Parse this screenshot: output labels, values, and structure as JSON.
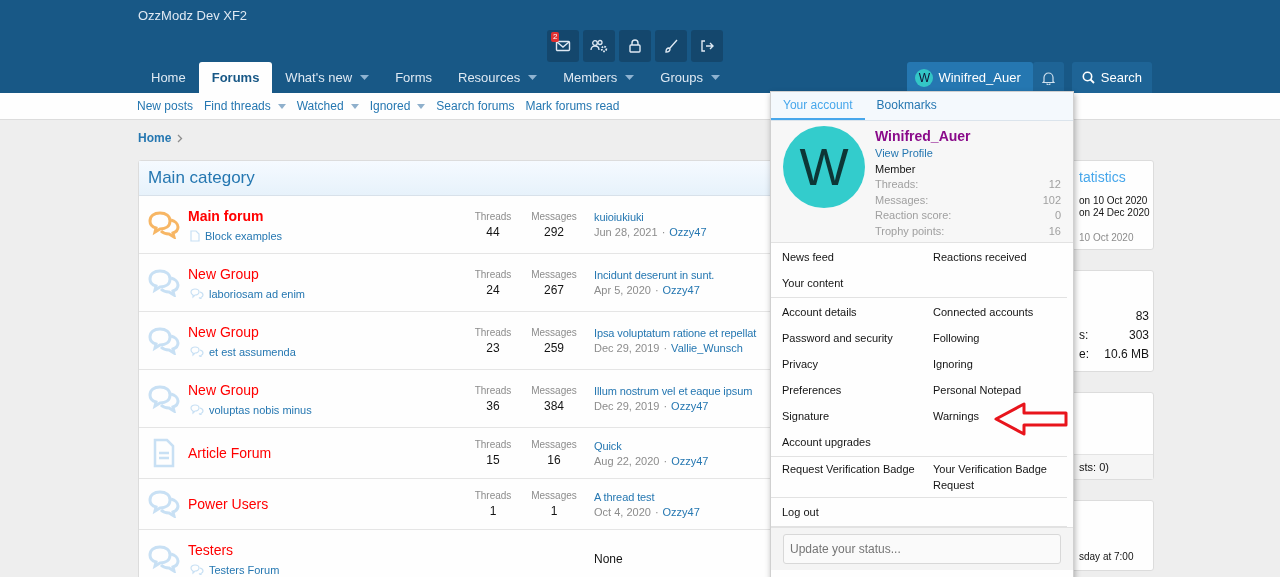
{
  "site_title": "OzzModz Dev XF2",
  "top_icons": [
    {
      "kind": "mail",
      "badge": "2"
    },
    {
      "kind": "people"
    },
    {
      "kind": "lock"
    },
    {
      "kind": "brush"
    },
    {
      "kind": "exit"
    }
  ],
  "nav_tabs": [
    {
      "label": "Home",
      "selected": false,
      "has_menu": false
    },
    {
      "label": "Forums",
      "selected": true,
      "has_menu": false
    },
    {
      "label": "What's new",
      "selected": false,
      "has_menu": true
    },
    {
      "label": "Forms",
      "selected": false,
      "has_menu": false
    },
    {
      "label": "Resources",
      "selected": false,
      "has_menu": true
    },
    {
      "label": "Members",
      "selected": false,
      "has_menu": true
    },
    {
      "label": "Groups",
      "selected": false,
      "has_menu": true
    }
  ],
  "user_button": {
    "initial": "W",
    "name": "Winifred_Auer",
    "open": true
  },
  "search_button": "Search",
  "sub_nav": [
    {
      "label": "New posts",
      "has_menu": false
    },
    {
      "label": "Find threads",
      "has_menu": true
    },
    {
      "label": "Watched",
      "has_menu": true
    },
    {
      "label": "Ignored",
      "has_menu": true
    },
    {
      "label": "Search forums",
      "has_menu": false
    },
    {
      "label": "Mark forums read",
      "has_menu": false
    }
  ],
  "breadcrumb": "Home",
  "category": {
    "title": "Main category",
    "forums": [
      {
        "kind": "chat",
        "title": "Main forum",
        "unread": true,
        "sub": {
          "kind": "page",
          "label": "Block examples"
        },
        "threads_label": "Threads",
        "threads": "44",
        "messages_label": "Messages",
        "messages": "292",
        "latest_title": "kuioiukiuki",
        "latest_date": "Jun 28, 2021",
        "separator": "·",
        "latest_user": "Ozzy47"
      },
      {
        "kind": "chat",
        "title": "New Group",
        "unread": false,
        "sub": {
          "kind": "chat",
          "label": "laboriosam ad enim"
        },
        "threads_label": "Threads",
        "threads": "24",
        "messages_label": "Messages",
        "messages": "267",
        "latest_title": "Incidunt deserunt in sunt.",
        "latest_date": "Apr 5, 2020",
        "separator": "·",
        "latest_user": "Ozzy47"
      },
      {
        "kind": "chat",
        "title": "New Group",
        "unread": false,
        "sub": {
          "kind": "chat",
          "label": "et est assumenda"
        },
        "threads_label": "Threads",
        "threads": "23",
        "messages_label": "Messages",
        "messages": "259",
        "latest_title": "Ipsa voluptatum ratione et repellat",
        "latest_date": "Dec 29, 2019",
        "separator": "·",
        "latest_user": "Vallie_Wunsch"
      },
      {
        "kind": "chat",
        "title": "New Group",
        "unread": false,
        "sub": {
          "kind": "chat",
          "label": "voluptas nobis minus"
        },
        "threads_label": "Threads",
        "threads": "36",
        "messages_label": "Messages",
        "messages": "384",
        "latest_title": "Illum nostrum vel et eaque ipsum",
        "latest_date": "Dec 29, 2019",
        "separator": "·",
        "latest_user": "Ozzy47"
      },
      {
        "kind": "article",
        "title": "Article Forum",
        "unread": false,
        "threads_label": "Threads",
        "threads": "15",
        "messages_label": "Messages",
        "messages": "16",
        "latest_title": "Quick",
        "latest_date": "Aug 22, 2020",
        "separator": "·",
        "latest_user": "Ozzy47"
      },
      {
        "kind": "chat",
        "title": "Power Users",
        "unread": false,
        "threads_label": "Threads",
        "threads": "1",
        "messages_label": "Messages",
        "messages": "1",
        "latest_title": "A thread test",
        "latest_date": "Oct 4, 2020",
        "separator": "·",
        "latest_user": "Ozzy47"
      },
      {
        "kind": "chat",
        "title": "Testers",
        "unread": false,
        "sub": {
          "kind": "chat",
          "label": "Testers Forum"
        },
        "latest_none": "None"
      }
    ]
  },
  "sidebar": [
    {
      "title": "tatistics",
      "lines": [
        "on 10 Oct 2020",
        "on 24 Dec 2020"
      ],
      "footer": "10 Oct 2020"
    },
    {
      "rows": [
        {
          "label": "",
          "value": "83"
        },
        {
          "label": "s:",
          "value": "303"
        },
        {
          "label": "e:",
          "value": "10.6 MB"
        }
      ]
    },
    {
      "footer": "sts: 0)"
    },
    {
      "lines": [
        "sday at 7:00"
      ]
    }
  ],
  "account_menu": {
    "tabs": [
      {
        "label": "Your account",
        "selected": true
      },
      {
        "label": "Bookmarks",
        "selected": false
      }
    ],
    "profile": {
      "initial": "W",
      "name": "Winifred_Auer",
      "link": "View Profile",
      "role": "Member",
      "stats": [
        {
          "label": "Threads:",
          "value": "12"
        },
        {
          "label": "Messages:",
          "value": "102"
        },
        {
          "label": "Reaction score:",
          "value": "0"
        },
        {
          "label": "Trophy points:",
          "value": "16"
        }
      ]
    },
    "link_groups": [
      [
        "News feed",
        "Reactions received",
        "Your content"
      ],
      [
        "Account details",
        "Connected accounts",
        "Password and security",
        "Following",
        "Privacy",
        "Ignoring",
        "Preferences",
        "Personal Notepad",
        "Signature",
        "Warnings",
        "Account upgrades"
      ],
      [
        "Request Verification Badge",
        "Your Verification Badge Request"
      ],
      [
        "Log out"
      ]
    ],
    "status_placeholder": "Update your status..."
  }
}
